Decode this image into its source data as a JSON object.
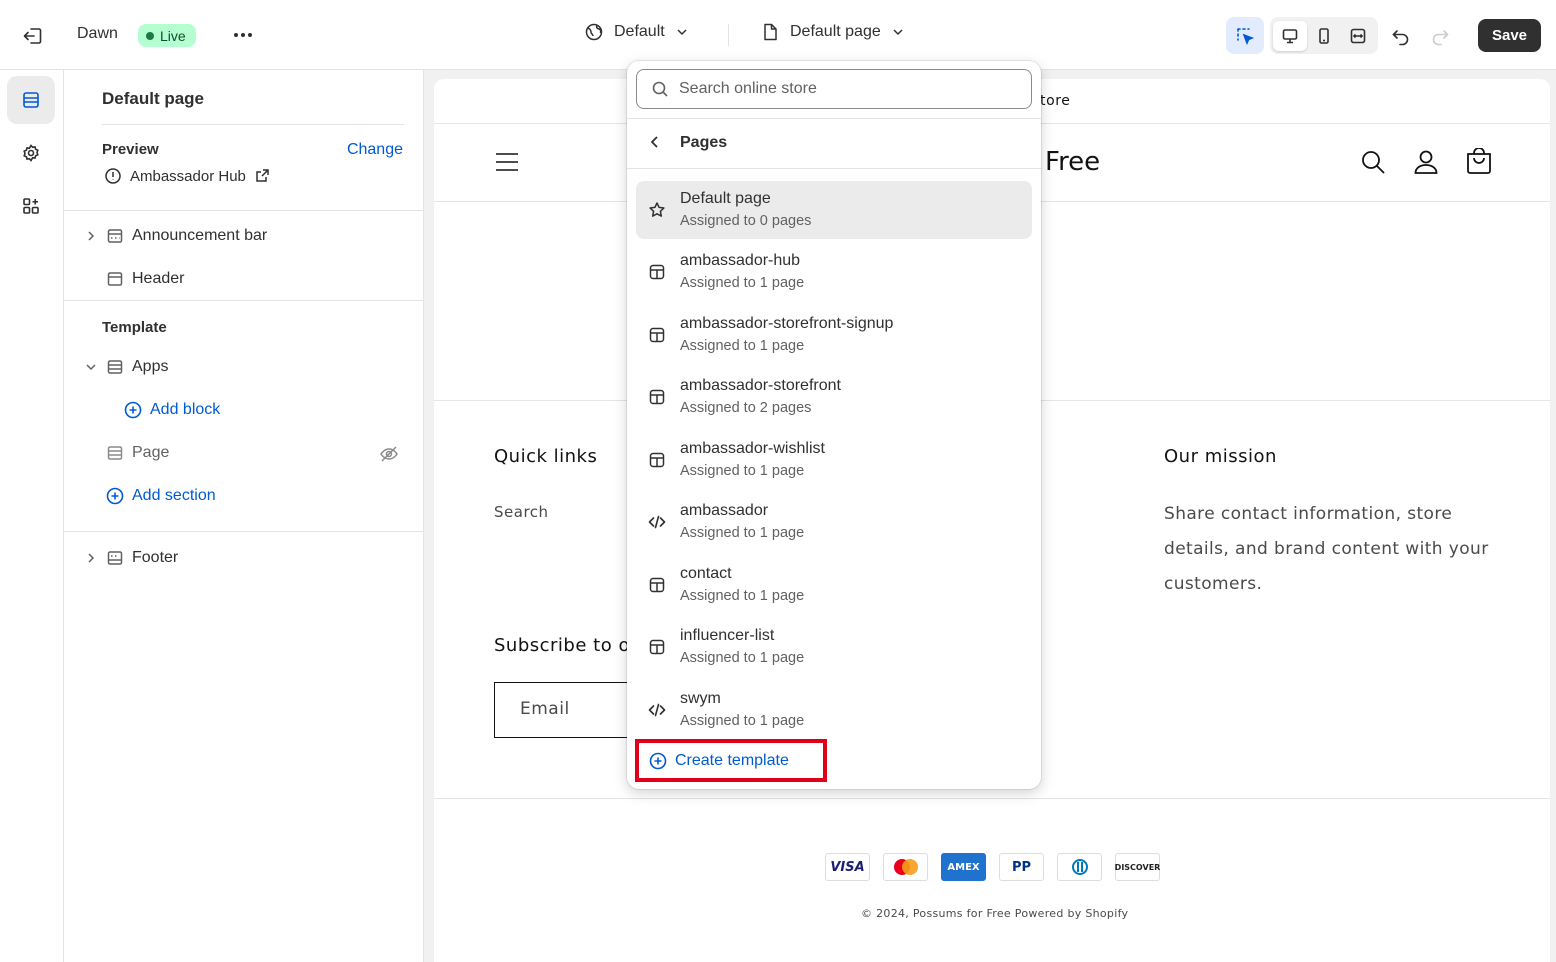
{
  "topbar": {
    "theme_name": "Dawn",
    "live_badge": "Live",
    "theme_select": "Default",
    "page_select": "Default page",
    "save_label": "Save"
  },
  "sidebar": {
    "title": "Default page",
    "preview_label": "Preview",
    "change_label": "Change",
    "preview_value": "Ambassador Hub",
    "sections": {
      "announcement": "Announcement bar",
      "header": "Header",
      "template_label": "Template",
      "apps": "Apps",
      "add_block": "Add block",
      "page": "Page",
      "add_section": "Add section",
      "footer": "Footer"
    }
  },
  "canvas": {
    "announcement_text": "tore",
    "brand_text": "Free",
    "quick_links_heading": "Quick links",
    "search_link": "Search",
    "mission_heading": "Our mission",
    "mission_text": "Share contact information, store details, and brand content with your customers.",
    "subscribe_heading": "Subscribe to ou",
    "email_placeholder": "Email",
    "payment_methods": [
      "VISA",
      "MC",
      "AMEX",
      "PP",
      "DC",
      "DISCOVER"
    ],
    "copyright": "© 2024, Possums for Free Powered by Shopify"
  },
  "popover": {
    "search_placeholder": "Search online store",
    "title": "Pages",
    "items": [
      {
        "name": "Default page",
        "sub": "Assigned to 0 pages",
        "icon": "star-icon"
      },
      {
        "name": "ambassador-hub",
        "sub": "Assigned to 1 page",
        "icon": "template-icon"
      },
      {
        "name": "ambassador-storefront-signup",
        "sub": "Assigned to 1 page",
        "icon": "template-icon"
      },
      {
        "name": "ambassador-storefront",
        "sub": "Assigned to 2 pages",
        "icon": "template-icon"
      },
      {
        "name": "ambassador-wishlist",
        "sub": "Assigned to 1 page",
        "icon": "template-icon"
      },
      {
        "name": "ambassador",
        "sub": "Assigned to 1 page",
        "icon": "code-icon"
      },
      {
        "name": "contact",
        "sub": "Assigned to 1 page",
        "icon": "template-icon"
      },
      {
        "name": "influencer-list",
        "sub": "Assigned to 1 page",
        "icon": "template-icon"
      },
      {
        "name": "swym",
        "sub": "Assigned to 1 page",
        "icon": "code-icon"
      }
    ],
    "create_label": "Create template"
  },
  "colors": {
    "accent": "#005bd3",
    "highlight_border": "#e0001a",
    "save_bg": "#303030",
    "live_bg": "#b4fed2"
  }
}
